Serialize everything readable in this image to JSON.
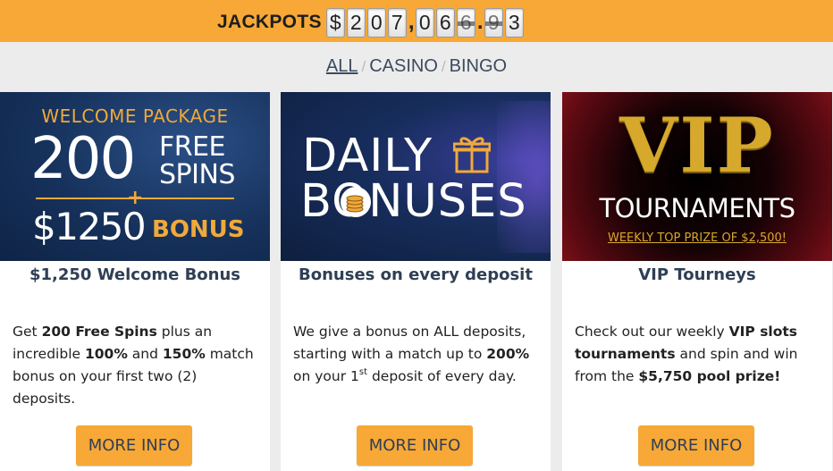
{
  "jackpot": {
    "label": "JACKPOTS",
    "digits": [
      "$",
      "2",
      "0",
      "7",
      ",",
      "0",
      "6",
      "6",
      ".",
      "9",
      "3"
    ]
  },
  "filter_nav": {
    "items": [
      "ALL",
      "CASINO",
      "BINGO"
    ],
    "active": "ALL",
    "separator": "/"
  },
  "cards": [
    {
      "banner": {
        "line1": "WELCOME PACKAGE",
        "big": "200",
        "free": "FREE",
        "spins": "SPINS",
        "plus": "+",
        "amount": "$1250",
        "bonus": "BONUS"
      },
      "title": "$1,250 Welcome Bonus",
      "desc": {
        "p1": "Get ",
        "b1": "200 Free Spins",
        "p2": " plus an incredible ",
        "b2": "100%",
        "p3": " and ",
        "b3": "150%",
        "p4": " match bonus on your first two (2) deposits."
      },
      "button": "MORE INFO"
    },
    {
      "banner": {
        "line1": "DAILY",
        "line2": "BONUSES"
      },
      "title": "Bonuses on every deposit",
      "desc": {
        "p1": "We give a bonus on ALL deposits, starting with a match up to ",
        "b1": "200%",
        "p2": " on your 1",
        "sup": "st",
        "p3": " deposit of every day."
      },
      "button": "MORE INFO"
    },
    {
      "banner": {
        "vip": "VIP",
        "tournaments": "TOURNAMENTS",
        "prize": "WEEKLY TOP PRIZE OF $2,500!"
      },
      "title": "VIP Tourneys",
      "desc": {
        "p1": "Check out our weekly ",
        "b1": "VIP slots tournaments",
        "p2": " and spin and win from the ",
        "b2": "$5,750 pool prize!"
      },
      "button": "MORE INFO"
    }
  ],
  "colors": {
    "accent": "#f7a836",
    "title": "#2f3f55",
    "background": "#ececec"
  },
  "icons": [
    "gift-icon",
    "coins-icon"
  ]
}
